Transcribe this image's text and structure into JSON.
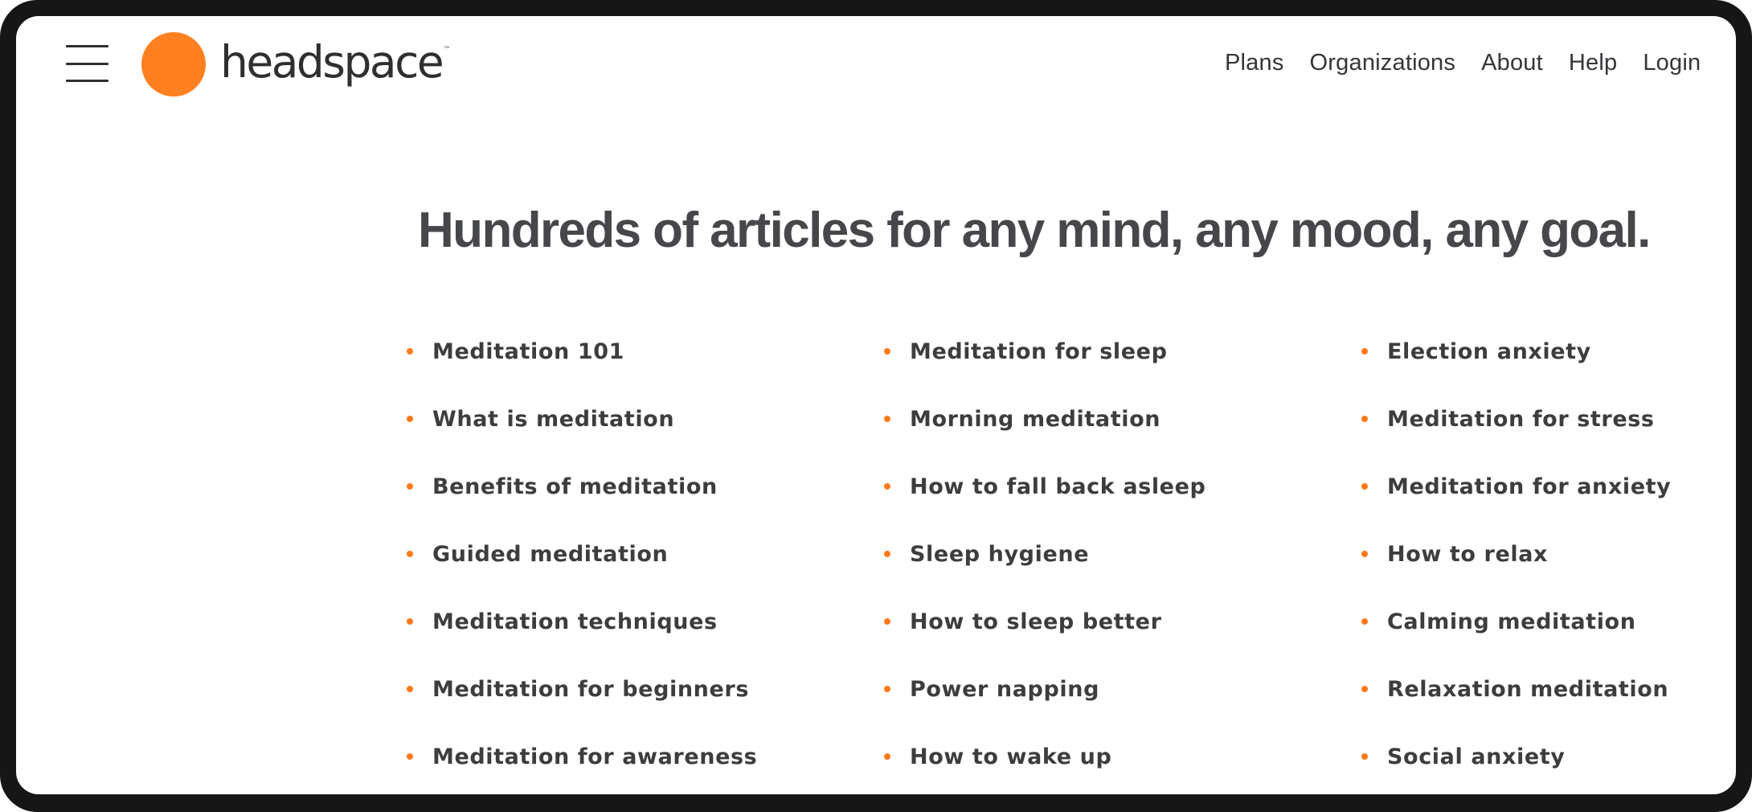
{
  "brand": {
    "name": "headspace",
    "trademark": "™",
    "accent_color": "#FF8021"
  },
  "header": {
    "menu_icon": "hamburger-menu-icon",
    "nav": [
      {
        "label": "Plans"
      },
      {
        "label": "Organizations"
      },
      {
        "label": "About"
      },
      {
        "label": "Help"
      },
      {
        "label": "Login"
      }
    ]
  },
  "main": {
    "headline": "Hundreds of articles for any mind, any mood, any goal.",
    "columns": [
      {
        "items": [
          "Meditation 101",
          "What is meditation",
          "Benefits of meditation",
          "Guided meditation",
          "Meditation techniques",
          "Meditation for beginners",
          "Meditation for awareness"
        ]
      },
      {
        "items": [
          "Meditation for sleep",
          "Morning meditation",
          "How to fall back asleep",
          "Sleep hygiene",
          "How to sleep better",
          "Power napping",
          "How to wake up"
        ]
      },
      {
        "items": [
          "Election anxiety",
          "Meditation for stress",
          "Meditation for anxiety",
          "How to relax",
          "Calming meditation",
          "Relaxation meditation",
          "Social anxiety"
        ]
      }
    ]
  }
}
